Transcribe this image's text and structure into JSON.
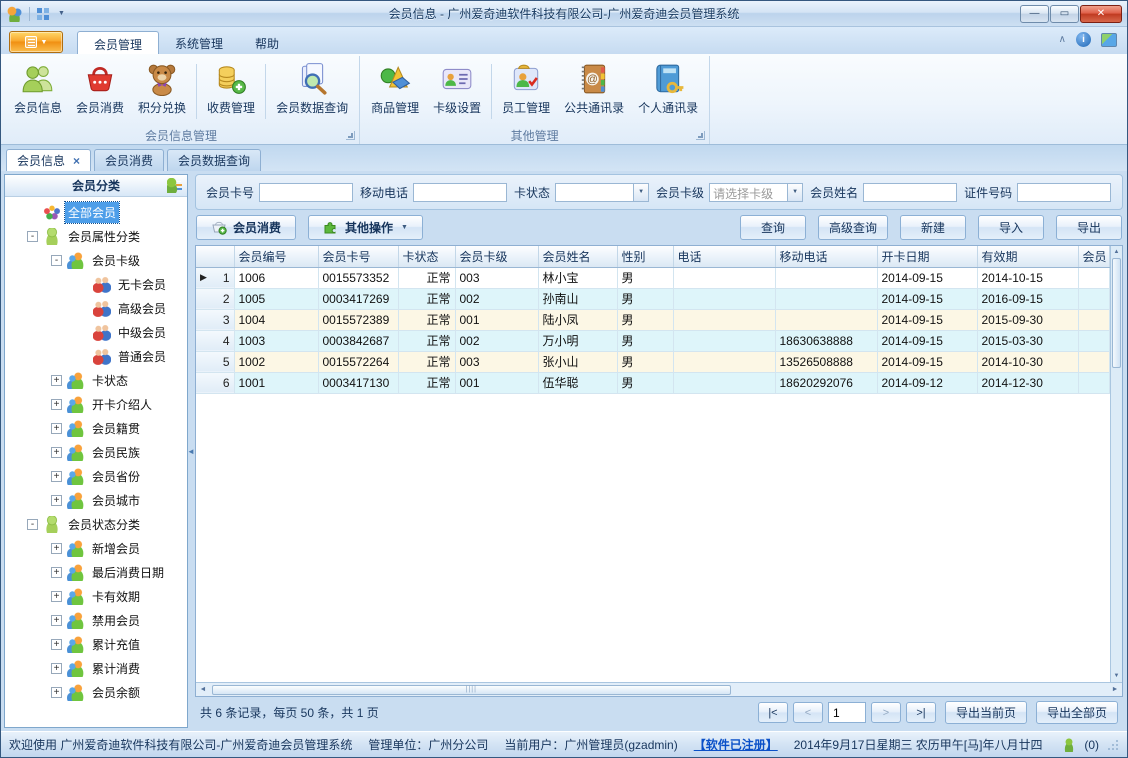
{
  "icons": {
    "dropdown": "▼",
    "chevron_up": "∧",
    "info": "i",
    "left_arrow": "◄",
    "right_arrow": "►",
    "up_arrow": "▲",
    "down_arrow": "▼",
    "splitter_left": "◄",
    "h_grip": "||||"
  },
  "window": {
    "title": "会员信息 - 广州爱奇迪软件科技有限公司-广州爱奇迪会员管理系统",
    "controls": {
      "minimize": "—",
      "maximize": "▭",
      "close": "✕"
    }
  },
  "ribbon": {
    "tabs": [
      "会员管理",
      "系统管理",
      "帮助"
    ],
    "group1": {
      "caption": "会员信息管理",
      "items": [
        "会员信息",
        "会员消费",
        "积分兑换",
        "收费管理",
        "会员数据查询"
      ]
    },
    "group2": {
      "caption": "其他管理",
      "items": [
        "商品管理",
        "卡级设置",
        "员工管理",
        "公共通讯录",
        "个人通讯录"
      ]
    }
  },
  "doc_tabs": [
    {
      "label": "会员信息",
      "close": "×"
    },
    {
      "label": "会员消费"
    },
    {
      "label": "会员数据查询"
    }
  ],
  "sidebar": {
    "header": "会员分类",
    "items": [
      {
        "label": "全部会员",
        "cls": "lvl0 sel",
        "icon": "ic-cluster",
        "exp": ""
      },
      {
        "label": "会员属性分类",
        "cls": "lvl0",
        "icon": "ic-green",
        "exp": "-"
      },
      {
        "label": "会员卡级",
        "cls": "lvl1",
        "icon": "ic-duo",
        "exp": "-"
      },
      {
        "label": "无卡会员",
        "cls": "lvl2",
        "icon": "ic-pair",
        "exp": ""
      },
      {
        "label": "高级会员",
        "cls": "lvl2",
        "icon": "ic-pair",
        "exp": ""
      },
      {
        "label": "中级会员",
        "cls": "lvl2",
        "icon": "ic-pair",
        "exp": ""
      },
      {
        "label": "普通会员",
        "cls": "lvl2",
        "icon": "ic-pair",
        "exp": ""
      },
      {
        "label": "卡状态",
        "cls": "lvl1",
        "icon": "ic-duo",
        "exp": "+"
      },
      {
        "label": "开卡介绍人",
        "cls": "lvl1",
        "icon": "ic-duo",
        "exp": "+"
      },
      {
        "label": "会员籍贯",
        "cls": "lvl1",
        "icon": "ic-duo",
        "exp": "+"
      },
      {
        "label": "会员民族",
        "cls": "lvl1",
        "icon": "ic-duo",
        "exp": "+"
      },
      {
        "label": "会员省份",
        "cls": "lvl1",
        "icon": "ic-duo",
        "exp": "+"
      },
      {
        "label": "会员城市",
        "cls": "lvl1",
        "icon": "ic-duo",
        "exp": "+"
      },
      {
        "label": "会员状态分类",
        "cls": "lvl0",
        "icon": "ic-green",
        "exp": "-"
      },
      {
        "label": "新增会员",
        "cls": "lvl1",
        "icon": "ic-duo",
        "exp": "+"
      },
      {
        "label": "最后消费日期",
        "cls": "lvl1",
        "icon": "ic-duo",
        "exp": "+"
      },
      {
        "label": "卡有效期",
        "cls": "lvl1",
        "icon": "ic-duo",
        "exp": "+"
      },
      {
        "label": "禁用会员",
        "cls": "lvl1",
        "icon": "ic-duo",
        "exp": "+"
      },
      {
        "label": "累计充值",
        "cls": "lvl1",
        "icon": "ic-duo",
        "exp": "+"
      },
      {
        "label": "累计消费",
        "cls": "lvl1",
        "icon": "ic-duo",
        "exp": "+"
      },
      {
        "label": "会员余额",
        "cls": "lvl1",
        "icon": "ic-duo",
        "exp": "+"
      }
    ]
  },
  "filters": {
    "fields": [
      {
        "label": "会员卡号",
        "cls": "kind-input",
        "value": ""
      },
      {
        "label": "移动电话",
        "cls": "kind-input",
        "value": ""
      },
      {
        "label": "卡状态",
        "cls": "kind-select",
        "value": ""
      },
      {
        "label": "会员卡级",
        "cls": "kind-select ph",
        "value": "请选择卡级"
      },
      {
        "label": "会员姓名",
        "cls": "kind-input",
        "value": ""
      },
      {
        "label": "证件号码",
        "cls": "kind-input",
        "value": ""
      }
    ]
  },
  "toolbar": {
    "consume": "会员消费",
    "other": "其他操作",
    "query": "查询",
    "adv_query": "高级查询",
    "new": "新建",
    "import": "导入",
    "export": "导出"
  },
  "grid": {
    "columns": [
      "",
      "会员编号",
      "会员卡号",
      "卡状态",
      "会员卡级",
      "会员姓名",
      "性别",
      "电话",
      "移动电话",
      "开卡日期",
      "有效期",
      "会员"
    ],
    "rows": [
      {
        "arrow": "▶",
        "num": "1",
        "cls": "row-white",
        "cells": [
          "1006",
          "0015573352",
          "正常",
          "003",
          "林小宝",
          "男",
          "",
          "",
          "2014-09-15",
          "2014-10-15",
          ""
        ]
      },
      {
        "arrow": "",
        "num": "2",
        "cls": "row-cyan",
        "cells": [
          "1005",
          "0003417269",
          "正常",
          "002",
          "孙南山",
          "男",
          "",
          "",
          "2014-09-15",
          "2016-09-15",
          ""
        ]
      },
      {
        "arrow": "",
        "num": "3",
        "cls": "row-cream",
        "cells": [
          "1004",
          "0015572389",
          "正常",
          "001",
          "陆小凤",
          "男",
          "",
          "",
          "2014-09-15",
          "2015-09-30",
          ""
        ]
      },
      {
        "arrow": "",
        "num": "4",
        "cls": "row-cyan",
        "cells": [
          "1003",
          "0003842687",
          "正常",
          "002",
          "万小明",
          "男",
          "",
          "18630638888",
          "2014-09-15",
          "2015-03-30",
          ""
        ]
      },
      {
        "arrow": "",
        "num": "5",
        "cls": "row-cream",
        "cells": [
          "1002",
          "0015572264",
          "正常",
          "003",
          "张小山",
          "男",
          "",
          "13526508888",
          "2014-09-15",
          "2014-10-30",
          ""
        ]
      },
      {
        "arrow": "",
        "num": "6",
        "cls": "row-cyan",
        "cells": [
          "1001",
          "0003417130",
          "正常",
          "001",
          "伍华聪",
          "男",
          "",
          "18620292076",
          "2014-09-12",
          "2014-12-30",
          ""
        ]
      }
    ]
  },
  "pager": {
    "summary": "共 6 条记录，每页 50 条，共 1 页",
    "first": "|<",
    "prev": "<",
    "page": "1",
    "next": ">",
    "last": ">|",
    "export_page": "导出当前页",
    "export_all": "导出全部页"
  },
  "statusbar": {
    "welcome": "欢迎使用 广州爱奇迪软件科技有限公司-广州爱奇迪会员管理系统",
    "org": "管理单位：广州分公司",
    "user": "当前用户：广州管理员(gzadmin)",
    "registered": "【软件已注册】",
    "date": "2014年9月17日星期三 农历甲午[马]年八月廿四",
    "msg_count": "(0)"
  }
}
